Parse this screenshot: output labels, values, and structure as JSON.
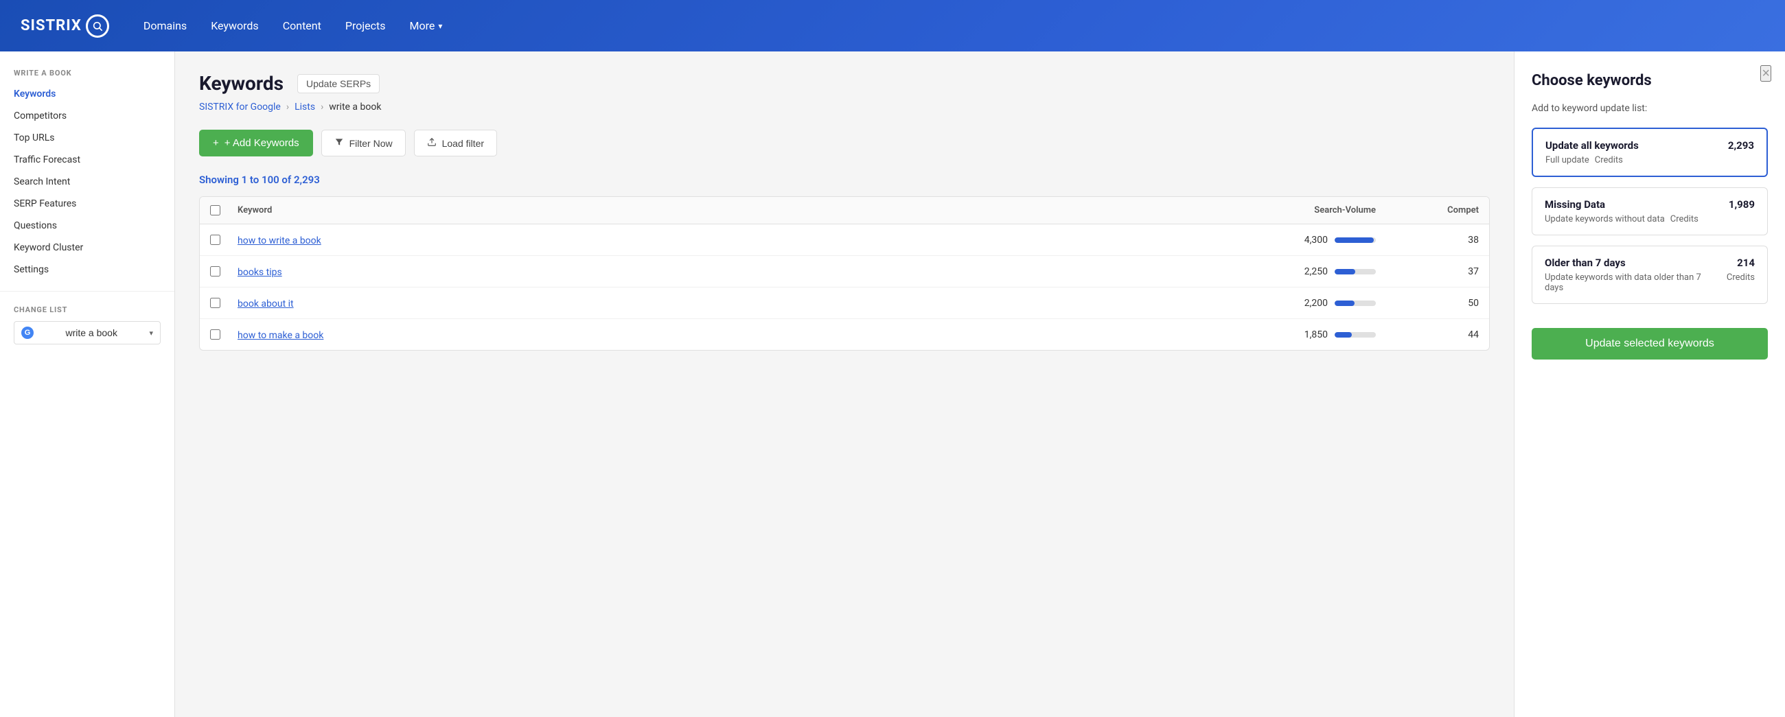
{
  "header": {
    "logo_text": "SISTRIX",
    "logo_symbol": "🔍",
    "nav_items": [
      {
        "label": "Domains",
        "id": "domains"
      },
      {
        "label": "Keywords",
        "id": "keywords"
      },
      {
        "label": "Content",
        "id": "content"
      },
      {
        "label": "Projects",
        "id": "projects"
      },
      {
        "label": "More",
        "id": "more",
        "has_arrow": true
      }
    ]
  },
  "sidebar": {
    "section_title": "WRITE A BOOK",
    "items": [
      {
        "label": "Keywords",
        "id": "keywords",
        "active": true
      },
      {
        "label": "Competitors",
        "id": "competitors"
      },
      {
        "label": "Top URLs",
        "id": "top-urls"
      },
      {
        "label": "Traffic Forecast",
        "id": "traffic-forecast"
      },
      {
        "label": "Search Intent",
        "id": "search-intent"
      },
      {
        "label": "SERP Features",
        "id": "serp-features"
      },
      {
        "label": "Questions",
        "id": "questions"
      },
      {
        "label": "Keyword Cluster",
        "id": "keyword-cluster"
      },
      {
        "label": "Settings",
        "id": "settings"
      }
    ],
    "change_list": {
      "label": "CHANGE LIST",
      "g_label": "G",
      "list_name": "write a book",
      "arrow": "▾"
    }
  },
  "content": {
    "page_title": "Keywords",
    "update_serps_label": "Update SERPs",
    "breadcrumb": {
      "parts": [
        "SISTRIX for Google",
        "Lists",
        "write a book"
      ],
      "separator": "›"
    },
    "add_keywords_label": "+ Add Keywords",
    "filter_now_label": "Filter Now",
    "load_filter_label": "Load filter",
    "showing_text": "Showing 1 to 100 of 2,293",
    "table": {
      "headers": [
        "",
        "Keyword",
        "Search-Volume",
        "Compet"
      ],
      "rows": [
        {
          "keyword": "how to write a book",
          "volume": 4300,
          "volume_pct": 95,
          "compet": "38"
        },
        {
          "keyword": "books tips",
          "volume": 2250,
          "volume_pct": 50,
          "compet": "37"
        },
        {
          "keyword": "book about it",
          "volume": 2200,
          "volume_pct": 48,
          "compet": "50"
        },
        {
          "keyword": "how to make a book",
          "volume": 1850,
          "volume_pct": 42,
          "compet": "44"
        }
      ]
    }
  },
  "right_panel": {
    "title": "Choose keywords",
    "close_symbol": "×",
    "subtitle": "Add to keyword update list:",
    "options": [
      {
        "id": "all",
        "title": "Update all keywords",
        "count": "2,293",
        "desc_left": "Full update",
        "desc_right": "Credits",
        "selected": true
      },
      {
        "id": "missing",
        "title": "Missing Data",
        "count": "1,989",
        "desc_left": "Update keywords without data",
        "desc_right": "Credits",
        "selected": false
      },
      {
        "id": "older",
        "title": "Older than 7 days",
        "count": "214",
        "desc_left": "Update keywords with data older than 7 days",
        "desc_right": "Credits",
        "selected": false
      }
    ],
    "update_button_label": "Update selected keywords"
  }
}
